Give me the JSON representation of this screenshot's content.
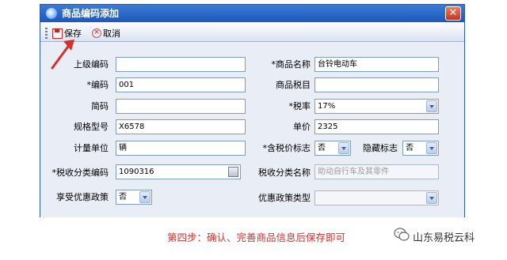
{
  "window": {
    "title": "商品编码添加",
    "close_glyph": "✕"
  },
  "toolbar": {
    "save_label": "保存",
    "cancel_label": "取消"
  },
  "form": {
    "parent_code": {
      "label": "上级编码",
      "value": ""
    },
    "product_name": {
      "label": "*商品名称",
      "value": "台铃电动车"
    },
    "code": {
      "label": "*编码",
      "value": "001"
    },
    "tax_item": {
      "label": "商品税目",
      "value": ""
    },
    "short_code": {
      "label": "简码",
      "value": ""
    },
    "tax_rate": {
      "label": "*税率",
      "value": "17%"
    },
    "spec_model": {
      "label": "规格型号",
      "value": "X6578"
    },
    "unit_price": {
      "label": "单价",
      "value": "2325"
    },
    "unit": {
      "label": "计量单位",
      "value": "辆"
    },
    "tax_included_flag": {
      "label": "*含税价标志",
      "value": "否"
    },
    "hidden_flag": {
      "label": "隐藏标志",
      "value": "否"
    },
    "tax_class_code": {
      "label": "*税收分类编码",
      "value": "1090316"
    },
    "tax_class_name": {
      "label": "税收分类名称",
      "value": "助动自行车及其零件"
    },
    "preferential_policy": {
      "label": "享受优惠政策",
      "value": "否"
    },
    "preferential_type": {
      "label": "优惠政策类型",
      "value": ""
    }
  },
  "caption": "第四步：确认、完善商品信息后保存即可",
  "brand": "山东易税云科",
  "colors": {
    "title_bar": "#1e58b8",
    "annotation": "#d4302c",
    "form_bg": "#e9edf5"
  }
}
